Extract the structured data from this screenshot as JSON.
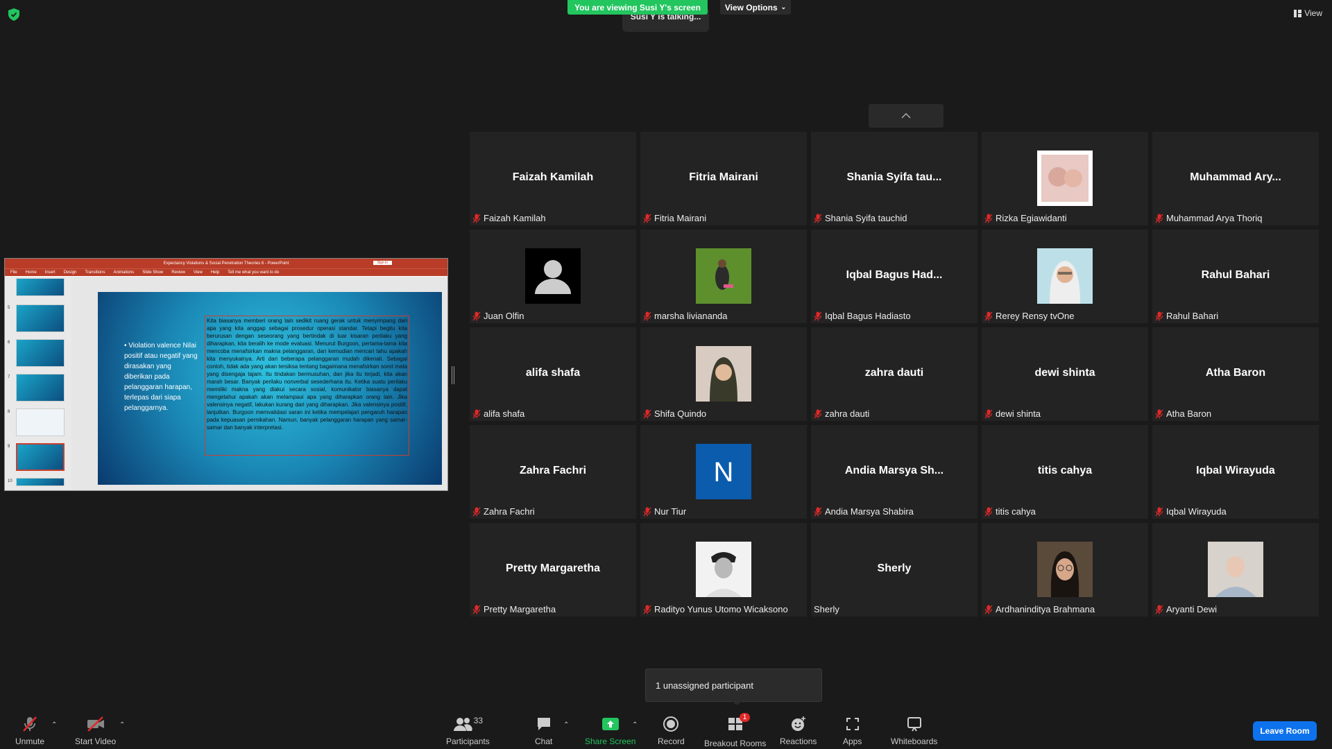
{
  "top": {
    "viewing_banner": "You are viewing Susi Y's screen",
    "view_options": "View Options",
    "talking": "Susi Y is talking...",
    "view": "View"
  },
  "share": {
    "window_title": "Expectancy Violations & Social Penetration Theories 6 - PowerPoint",
    "sign_in": "Sign in",
    "ribbon_tabs": [
      "File",
      "Home",
      "Insert",
      "Design",
      "Transitions",
      "Animations",
      "Slide Show",
      "Review",
      "View",
      "Help",
      "Tell me what you want to do"
    ],
    "thumb_numbers": [
      "5",
      "6",
      "7",
      "8",
      "9",
      "10"
    ],
    "slide_bullet": "• Violation valence Nilai positif atau negatif yang dirasakan yang diberikan pada pelanggaran harapan, terlepas dari siapa pelanggarnya.",
    "slide_text": "Kita biasanya memberi orang lain sedikit ruang gerak untuk menyimpang dari apa yang kita anggap sebagai prosedur operasi standar. Tetapi begitu kita berurusan dengan seseorang yang bertindak di luar kisaran perilaku yang diharapkan, kita beralih ke mode evaluasi. Menurut Burgoon, pertama-tama kita mencoba menafsirkan makna pelanggaran, dan kemudian mencari tahu apakah kita menyukainya. Arti dari beberapa pelanggaran mudah dikenali. Sebagai contoh, tidak ada yang akan tersiksa tentang bagaimana menafsirkan sorot mata yang disengaja tajam. Itu tindakan bermusuhan, dan jika itu terjadi, kita akan marah besar. Banyak perilaku nonverbal sesederhana itu. Ketika suatu perilaku memiliki makna yang diakui secara sosial, komunikator biasanya dapat mengetahui apakah akan melampaui apa yang diharapkan orang lain. Jika valensinya negatif, lakukan kurang dari yang diharapkan. Jika valensinya positif, lanjutkan. Burgoon memvalidasi saran ini ketika mempelajari pengaruh harapan pada kepuasan pernikahan. Namun, banyak pelanggaran harapan yang samar-samar dan banyak interpretasi."
  },
  "participants": [
    {
      "center": "Faizah Kamilah",
      "footer": "Faizah Kamilah",
      "avatar": ""
    },
    {
      "center": "Fitria Mairani",
      "footer": "Fitria Mairani",
      "avatar": ""
    },
    {
      "center": "Shania Syifa tau...",
      "footer": "Shania Syifa tauchid",
      "avatar": ""
    },
    {
      "center": "",
      "footer": "Rizka Egiawidanti",
      "avatar": "photo-pink"
    },
    {
      "center": "Muhammad Ary...",
      "footer": "Muhammad Arya Thoriq",
      "avatar": ""
    },
    {
      "center": "",
      "footer": "Juan Olfin",
      "avatar": "default-user"
    },
    {
      "center": "",
      "footer": "marsha livianandа",
      "avatar": "photo-grass"
    },
    {
      "center": "Iqbal Bagus Had...",
      "footer": "Iqbal Bagus Hadiasto",
      "avatar": ""
    },
    {
      "center": "",
      "footer": "Rerey Rensy tvOne",
      "avatar": "photo-hijab-white"
    },
    {
      "center": "Rahul Bahari",
      "footer": "Rahul Bahari",
      "avatar": ""
    },
    {
      "center": "alifa shafa",
      "footer": "alifa shafa",
      "avatar": ""
    },
    {
      "center": "",
      "footer": "Shifa Quindo",
      "avatar": "photo-hijab-dark"
    },
    {
      "center": "zahra dauti",
      "footer": "zahra dauti",
      "avatar": ""
    },
    {
      "center": "dewi shinta",
      "footer": "dewi shinta",
      "avatar": ""
    },
    {
      "center": "Atha Baron",
      "footer": "Atha Baron",
      "avatar": ""
    },
    {
      "center": "Zahra Fachri",
      "footer": "Zahra Fachri",
      "avatar": ""
    },
    {
      "center": "",
      "footer": "Nur Tiur",
      "avatar": "letter-N"
    },
    {
      "center": "Andia Marsya Sh...",
      "footer": "Andia Marsya Shabira",
      "avatar": ""
    },
    {
      "center": "titis cahya",
      "footer": "titis cahya",
      "avatar": ""
    },
    {
      "center": "Iqbal Wirayuda",
      "footer": "Iqbal Wirayuda",
      "avatar": ""
    },
    {
      "center": "Pretty Margaretha",
      "footer": "Pretty Margaretha",
      "avatar": ""
    },
    {
      "center": "",
      "footer": "Radityo Yunus Utomo Wicaksono",
      "avatar": "photo-bw"
    },
    {
      "center": "Sherly",
      "footer": "Sherly",
      "avatar": "",
      "unmuted": true
    },
    {
      "center": "",
      "footer": "Ardhaninditya Brahmana",
      "avatar": "photo-glasses"
    },
    {
      "center": "",
      "footer": "Aryanti Dewi",
      "avatar": "photo-pale"
    }
  ],
  "unassigned": "1 unassigned participant",
  "toolbar": {
    "unmute": "Unmute",
    "start_video": "Start Video",
    "participants": "Participants",
    "participant_count": "33",
    "chat": "Chat",
    "share_screen": "Share Screen",
    "record": "Record",
    "breakout_rooms": "Breakout Rooms",
    "breakout_badge": "1",
    "reactions": "Reactions",
    "apps": "Apps",
    "whiteboards": "Whiteboards",
    "leave_room": "Leave Room"
  },
  "colors": {
    "share_green": "#22c55e",
    "leave_blue": "#0e72ed",
    "mic_red": "#e02828",
    "ppt_red": "#b83c27"
  }
}
